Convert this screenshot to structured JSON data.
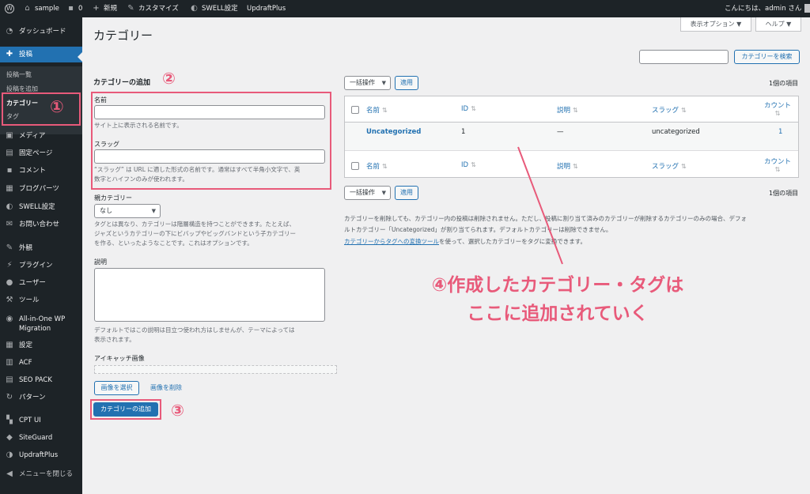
{
  "adminbar": {
    "site_name": "sample",
    "comments_count": "0",
    "new_label": "新規",
    "customize_label": "カスタマイズ",
    "swell_label": "SWELL設定",
    "updraft_label": "UpdraftPlus",
    "greeting": "こんにちは、admin さん"
  },
  "sidebar": {
    "dashboard": "ダッシュボード",
    "posts": "投稿",
    "submenu": {
      "all_posts": "投稿一覧",
      "add_post": "投稿を追加",
      "categories": "カテゴリー",
      "tags": "タグ"
    },
    "media": "メディア",
    "pages": "固定ページ",
    "comments": "コメント",
    "blog_parts": "ブログパーツ",
    "swell": "SWELL設定",
    "contact": "お問い合わせ",
    "appearance": "外観",
    "plugins": "プラグイン",
    "users": "ユーザー",
    "tools": "ツール",
    "aiowp": "All-in-One WP Migration",
    "settings": "設定",
    "acf": "ACF",
    "seo_pack": "SEO PACK",
    "patterns": "パターン",
    "cpt_ui": "CPT UI",
    "siteguard": "SiteGuard",
    "updraft": "UpdraftPlus",
    "collapse": "メニューを閉じる"
  },
  "header": {
    "title": "カテゴリー",
    "screen_options": "表示オプション ▼",
    "help": "ヘルプ ▼"
  },
  "search": {
    "button": "カテゴリーを検索",
    "value": ""
  },
  "form": {
    "heading": "カテゴリーの追加",
    "name_label": "名前",
    "name_desc": "サイト上に表示される名前です。",
    "slug_label": "スラッグ",
    "slug_desc_1": "“スラッグ” は URL に適した形式の名前です。通常はすべて半角小文字で、英",
    "slug_desc_2": "数字とハイフンのみが使われます。",
    "parent_label": "親カテゴリー",
    "parent_value": "なし",
    "parent_desc_1": "タグとは異なり、カテゴリーは階層構造を持つことができます。たとえば、",
    "parent_desc_2": "ジャズというカテゴリーの下にビバップやビッグバンドという子カテゴリー",
    "parent_desc_3": "を作る、といったようなことです。これはオプションです。",
    "desc_label": "説明",
    "desc_desc_1": "デフォルトではこの説明は目立つ使われ方はしませんが、テーマによっては",
    "desc_desc_2": "表示されます。",
    "eyecatch_label": "アイキャッチ画像",
    "select_image": "画像を選択",
    "remove_image": "画像を削除",
    "submit": "カテゴリーの追加"
  },
  "table": {
    "bulk_action": "一括操作",
    "apply": "適用",
    "count_text": "1個の項目",
    "headers": {
      "name": "名前",
      "id": "ID",
      "description": "説明",
      "slug": "スラッグ",
      "count": "カウント"
    },
    "rows": [
      {
        "name": "Uncategorized",
        "id": "1",
        "description": "—",
        "slug": "uncategorized",
        "count": "1"
      }
    ]
  },
  "notice": {
    "line1": "カテゴリーを削除しても、カテゴリー内の投稿は削除されません。ただし、投稿に割り当て済みのカテゴリーが削除するカテゴリーのみの場合、デフォ",
    "line2": "ルトカテゴリー「Uncategorized」が割り当てられます。デフォルトカテゴリーは削除できません。",
    "link_text": "カテゴリーからタグへの変換ツール",
    "line3_rest": "を使って、選択したカテゴリーをタグに変換できます。"
  },
  "annotations": {
    "step1": "①",
    "step2": "②",
    "step3": "③",
    "step4_line1": "④作成したカテゴリー・タグは",
    "step4_line2": "ここに追加されていく",
    "accent_color": "#e85a7a"
  }
}
